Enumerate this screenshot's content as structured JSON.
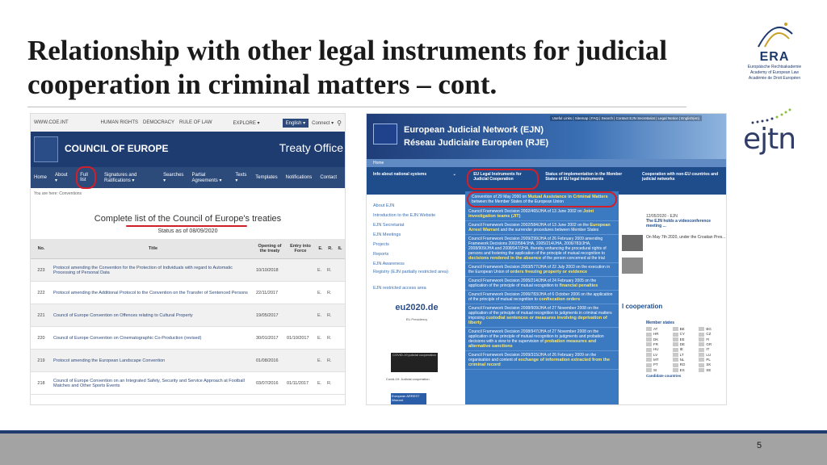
{
  "slide": {
    "title_line1": "Relationship with other legal instruments for judicial",
    "title_line2": "cooperation in criminal matters – cont.",
    "page_number": "5"
  },
  "era_logo": {
    "name": "ERA",
    "sub1": "Europäische Rechtsakademie",
    "sub2": "Academy of European Law",
    "sub3": "Académie de Droit Européen"
  },
  "ejtn_logo": {
    "name": "ejtn"
  },
  "coe": {
    "url": "WWW.COE.INT",
    "top_nav": [
      "HUMAN RIGHTS",
      "DEMOCRACY",
      "RULE OF LAW",
      "EXPLORE ▾"
    ],
    "lang": "English ▾",
    "connect": "Connect ▾",
    "name": "COUNCIL OF EUROPE",
    "office": "Treaty Office",
    "nav": [
      "Home",
      "About ▾",
      "Full list",
      "Signatures and Ratifications ▾",
      "Searches ▾",
      "Partial Agreements ▾",
      "Texts ▾",
      "Templates",
      "Notifications",
      "Contact"
    ],
    "breadcrumb": "You are here: Conventions",
    "list_title": "Complete list of the Council of Europe's treaties",
    "status": "Status as of 08/09/2020",
    "columns": [
      "No.",
      "Title",
      "Opening of the treaty",
      "Entry into Force",
      "E.",
      "R.",
      "IL"
    ],
    "rows": [
      {
        "no": "223",
        "title": "Protocol amending the Convention for the Protection of Individuals with regard to Automatic Processing of Personal Data",
        "opening": "10/10/2018",
        "entry": "",
        "e": "E.",
        "r": "R."
      },
      {
        "no": "222",
        "title": "Protocol amending the Additional Protocol to the Convention on the Transfer of Sentenced Persons",
        "opening": "22/11/2017",
        "entry": "",
        "e": "E.",
        "r": "R."
      },
      {
        "no": "221",
        "title": "Council of Europe Convention on Offences relating to Cultural Property",
        "opening": "19/05/2017",
        "entry": "",
        "e": "E.",
        "r": "R."
      },
      {
        "no": "220",
        "title": "Council of Europe Convention on Cinematographic Co-Production (revised)",
        "opening": "30/01/2017",
        "entry": "01/10/2017",
        "e": "E.",
        "r": "R."
      },
      {
        "no": "219",
        "title": "Protocol amending the European Landscape Convention",
        "opening": "01/08/2016",
        "entry": "",
        "e": "E.",
        "r": "R."
      },
      {
        "no": "218",
        "title": "Council of Europe Convention on an Integrated Safety, Security and Service Approach at Football Matches and Other Sports Events",
        "opening": "03/07/2016",
        "entry": "01/11/2017",
        "e": "E.",
        "r": "R."
      }
    ]
  },
  "ejn": {
    "top_links": "Useful Links | Sitemap | FAQ | Search | Contact EJN Secretariat | Legal Notice | English(en)",
    "title1": "European Judicial Network (EJN)",
    "title2": "Réseau Judiciaire Européen (RJE)",
    "home": "Home",
    "menu": [
      "Info about national systems",
      "EU Legal Instruments for Judicial Cooperation",
      "Status of implementation in the Member States of EU legal instruments",
      "Cooperation with non-EU countries and judicial networks"
    ],
    "side": [
      "About EJN",
      "Introduction to the EJN Website",
      "EJN Secretariat",
      "EJN Meetings",
      "Projects",
      "Reports",
      "EJN Awareness",
      "Registry (EJN partially restricted area)",
      "EJN restricted access area"
    ],
    "eu2020": "eu2020.de",
    "eu2020_cap": "EU Presidency",
    "covid": "COVID-19 judicial cooperation",
    "covid_cap": "Covid-19: Judicial cooperation",
    "arrest": "European ARREST Warrant",
    "instruments": [
      {
        "caption": "Convention of 29 May 2000 on",
        "link": "Mutual Assistance in Criminal Matters",
        "after": "between the Member States of the European Union"
      },
      {
        "caption": "Council Framework Decision 2002/465/JHA of 13 June 2002 on",
        "link": "Joint investigation teams (JIT)",
        "after": ""
      },
      {
        "caption": "Council Framework Decision 2002/584/JHA of 13 June 2002 on the",
        "link": "European Arrest Warrant",
        "after": "and the surrender procedures between Member States"
      },
      {
        "caption": "Council Framework Decision 2009/299/JHA of 26 February 2009 amending Framework Decisions 2002/584/JHA, 2005/214/JHA, 2006/783/JHA, 2008/909/JHA and 2008/947/JHA, thereby enhancing the procedural rights of persons and fostering the application of the principle of mutual recognition to",
        "link": "decisions rendered in the absence",
        "after": "of the person concerned at the trial"
      },
      {
        "caption": "Council Framework Decision 2003/577/JHA of 22 July 2003 on the execution in the European Union of",
        "link": "orders freezing property or evidence",
        "after": ""
      },
      {
        "caption": "Council Framework Decision 2005/214/JHA of 24 February 2005 on the application of the principle of mutual recognition to",
        "link": "financial penalties",
        "after": ""
      },
      {
        "caption": "Council Framework Decision 2006/783/JHA of 6 October 2006 on the application of the principle of mutual recognition to",
        "link": "confiscation orders",
        "after": ""
      },
      {
        "caption": "Council Framework Decision 2008/909/JHA of 27 November 2008 on the application of the principle of mutual recognition to judgments in criminal matters imposing",
        "link": "custodial sentences or measures involving deprivation of liberty",
        "after": ""
      },
      {
        "caption": "Council Framework Decision 2008/947/JHA of 27 November 2008 on the application of the principle of mutual recognition to judgments and probation decisions with a view to the supervision of",
        "link": "probation measures and alternative sanctions",
        "after": ""
      },
      {
        "caption": "Council Framework Decision 2009/315/JHA of 26 February 2009 on the organisation and content of",
        "link": "exchange of information extracted from the criminal record",
        "after": ""
      }
    ],
    "news1_date": "12/05/2020 - EJN",
    "news1_title": "The EJN holds a videoconference meeting ...",
    "news2": "On May 7th 2020, under the Croatian Pres...",
    "coop_heading": "l cooperation",
    "members_heading": "Member states",
    "members": [
      "AT",
      "BE",
      "BG",
      "HR",
      "CY",
      "CZ",
      "DK",
      "EE",
      "FI",
      "FR",
      "DE",
      "GR",
      "HU",
      "IE",
      "IT",
      "LV",
      "LT",
      "LU",
      "MT",
      "NL",
      "PL",
      "PT",
      "RO",
      "SK",
      "SI",
      "ES",
      "SE"
    ],
    "candidates": "Candidate countries"
  }
}
